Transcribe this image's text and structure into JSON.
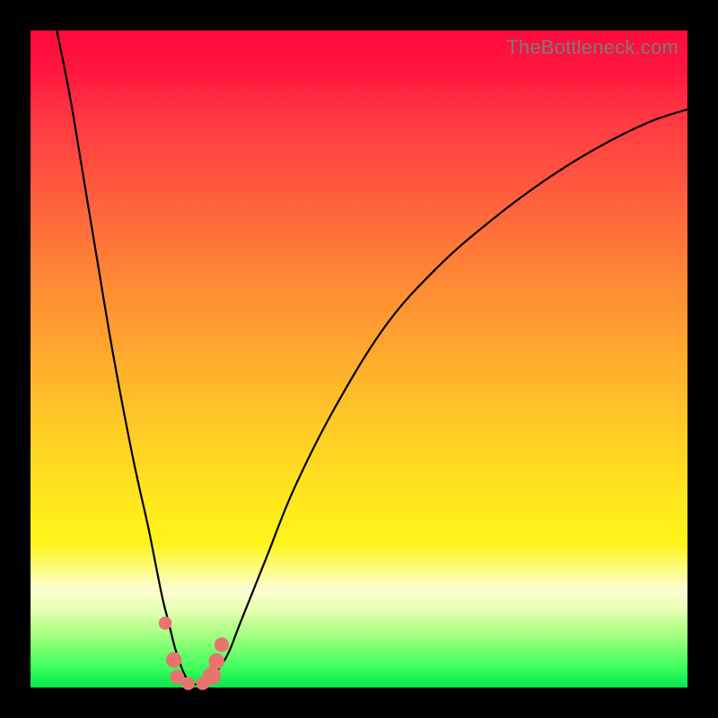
{
  "watermark": "TheBottleneck.com",
  "colors": {
    "frame": "#000000",
    "curve": "#000000",
    "marker": "#e9746f",
    "watermark_text": "#7a7a7a"
  },
  "chart_data": {
    "type": "line",
    "title": "",
    "xlabel": "",
    "ylabel": "",
    "xlim": [
      0,
      100
    ],
    "ylim": [
      0,
      100
    ],
    "grid": false,
    "legend": false,
    "note": "Values eyeballed from pixel positions; axes unlabelled so treated as 0–100.",
    "series": [
      {
        "name": "bottleneck-curve",
        "x": [
          4,
          6,
          8,
          10,
          12,
          14,
          16,
          18,
          20,
          21,
          22,
          23,
          24,
          25,
          26,
          27,
          28,
          30,
          32,
          36,
          40,
          46,
          54,
          62,
          70,
          78,
          86,
          94,
          100
        ],
        "y": [
          100,
          90,
          78,
          66,
          54,
          43,
          33,
          24,
          14,
          10,
          6,
          3,
          1,
          0.5,
          0.5,
          1,
          2,
          5,
          10,
          20,
          30,
          42,
          55,
          64,
          71,
          77,
          82,
          86,
          88
        ]
      }
    ],
    "markers": [
      {
        "x": 20.5,
        "y": 9.8,
        "r": 1.0
      },
      {
        "x": 21.8,
        "y": 4.2,
        "r": 1.2
      },
      {
        "x": 22.3,
        "y": 1.6,
        "r": 1.1
      },
      {
        "x": 24.0,
        "y": 0.6,
        "r": 1.0
      },
      {
        "x": 26.2,
        "y": 0.6,
        "r": 1.0
      },
      {
        "x": 27.6,
        "y": 1.8,
        "r": 1.4
      },
      {
        "x": 28.3,
        "y": 4.0,
        "r": 1.2
      },
      {
        "x": 29.1,
        "y": 6.5,
        "r": 1.1
      }
    ]
  }
}
